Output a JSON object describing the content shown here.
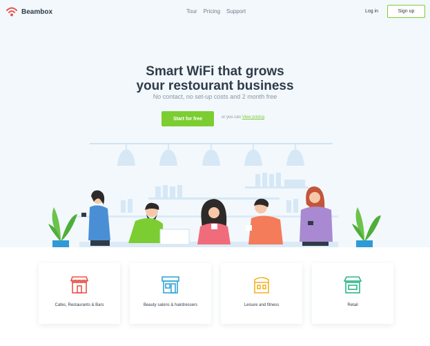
{
  "header": {
    "brand": "Beambox",
    "nav": [
      "Tour",
      "Pricing",
      "Support"
    ],
    "login_label": "Log in",
    "signup_label": "Sign up"
  },
  "hero": {
    "headline_line1": "Smart WiFi that grows",
    "headline_line2": "your restourant business",
    "subline": "No contact, no set-up costs and 2 month free",
    "cta_label": "Start for free",
    "or_text": "or you can ",
    "pricing_link": "View pricing"
  },
  "categories": [
    {
      "label": "Cafes, Restaurants & Bars",
      "icon": "storefront-icon",
      "color": "#e8534a"
    },
    {
      "label": "Beauty salons & hairdressers",
      "icon": "salon-icon",
      "color": "#2fa6d8"
    },
    {
      "label": "Leisure and fitness",
      "icon": "tent-icon",
      "color": "#f2b21f"
    },
    {
      "label": "Retail",
      "icon": "shop-icon",
      "color": "#2bb58a"
    }
  ],
  "colors": {
    "accent": "#7ccd31",
    "hero_bg": "#f2f8fc",
    "text": "#2f3b48",
    "logo": "#e8534a"
  }
}
